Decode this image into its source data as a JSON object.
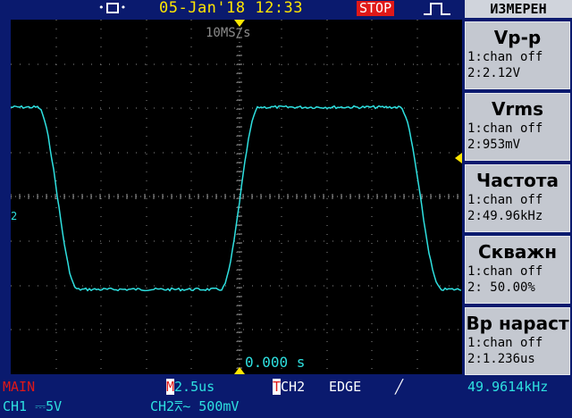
{
  "header": {
    "usb_icon": "usb-icon",
    "datetime": "05-Jan'18 12:33",
    "run_state": "STOP",
    "trigger_icon": "square-pulse-icon"
  },
  "screen": {
    "timebase_top": "10MS/s",
    "trigger_time": "0.000 s",
    "ch2_marker": "2"
  },
  "measure_panel": {
    "title": "ИЗМЕРЕН",
    "items": [
      {
        "title": "Vp-p",
        "line1": "1:chan off",
        "line2": "2:2.12V"
      },
      {
        "title": "Vrms",
        "line1": "1:chan off",
        "line2": "2:953mV"
      },
      {
        "title": "Частота",
        "line1": "1:chan off",
        "line2": "2:49.96kHz"
      },
      {
        "title": "Скважн",
        "line1": "1:chan off",
        "line2": "2: 50.00%"
      },
      {
        "title": "Вр нараст",
        "line1": "1:chan off",
        "line2": "2:1.236us"
      }
    ]
  },
  "status": {
    "main": "MAIN",
    "m_letter": "M",
    "m_value": "2.5us",
    "t_letter": "T",
    "t_value": "CH2",
    "edge": "EDGE",
    "slope": "╱",
    "frequency": "49.9614kHz",
    "ch1": "CH1 ⎓5V",
    "ch2": "CH2⩞∼ 500mV"
  },
  "colors": {
    "background": "#0a1a6e",
    "trace": "#2ee0e0",
    "date": "#ffe600",
    "stop": "#e01818"
  }
}
